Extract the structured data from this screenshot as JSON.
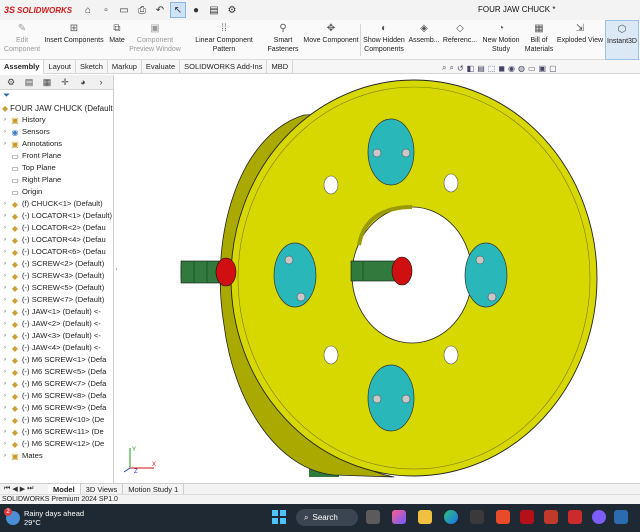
{
  "app": {
    "logo_text": "SOLIDWORKS",
    "logo_prefix": "3S",
    "document_title": "FOUR JAW CHUCK *"
  },
  "quick_access": [
    {
      "name": "home-icon",
      "glyph": "⌂"
    },
    {
      "name": "new-document-icon",
      "glyph": "▫"
    },
    {
      "name": "open-icon",
      "glyph": "▭"
    },
    {
      "name": "print-icon",
      "glyph": "⎙"
    },
    {
      "name": "undo-icon",
      "glyph": "↶"
    },
    {
      "name": "select-icon",
      "glyph": "↖"
    },
    {
      "name": "rebuild-icon",
      "glyph": "●"
    },
    {
      "name": "file-properties-icon",
      "glyph": "▤"
    },
    {
      "name": "options-icon",
      "glyph": "⚙"
    }
  ],
  "ribbon": {
    "edit_component": "Edit\nComponent",
    "insert_components": "Insert Components",
    "mate": "Mate",
    "component_preview": "Component\nPreview Window",
    "linear_pattern": "Linear Component Pattern",
    "smart_fasteners": "Smart\nFasteners",
    "move_component": "Move Component",
    "show_hidden": "Show Hidden\nComponents",
    "assembly": "Assemb...",
    "reference": "Referenc...",
    "new_motion_study": "New Motion\nStudy",
    "bill_of_materials": "Bill of\nMaterials",
    "exploded_view": "Exploded View",
    "instant3d": "Instant3D"
  },
  "command_tabs": [
    "Assembly",
    "Layout",
    "Sketch",
    "Markup",
    "Evaluate",
    "SOLIDWORKS Add-Ins",
    "MBD"
  ],
  "feature_tree": {
    "root": "FOUR JAW CHUCK  (Default",
    "items": [
      {
        "label": "History",
        "icon": "history-icon",
        "kind": "folder"
      },
      {
        "label": "Sensors",
        "icon": "sensor-icon",
        "kind": "sensor"
      },
      {
        "label": "Annotations",
        "icon": "annotations-icon",
        "kind": "folder"
      },
      {
        "label": "Front Plane",
        "icon": "plane-icon",
        "kind": "plane"
      },
      {
        "label": "Top Plane",
        "icon": "plane-icon",
        "kind": "plane"
      },
      {
        "label": "Right Plane",
        "icon": "plane-icon",
        "kind": "plane"
      },
      {
        "label": "Origin",
        "icon": "origin-icon",
        "kind": "plane"
      },
      {
        "label": "(f) CHUCK<1> (Default)",
        "icon": "part-icon",
        "kind": "part"
      },
      {
        "label": "(-) LOCATOR<1> (Default)",
        "icon": "part-icon",
        "kind": "part"
      },
      {
        "label": "(-) LOCATOR<2> (Defau",
        "icon": "part-icon",
        "kind": "part"
      },
      {
        "label": "(-) LOCATOR<4> (Defau",
        "icon": "part-icon",
        "kind": "part"
      },
      {
        "label": "(-) LOCATOR<6> (Defau",
        "icon": "part-icon",
        "kind": "part"
      },
      {
        "label": "(-) SCREW<2> (Default)",
        "icon": "part-icon",
        "kind": "part"
      },
      {
        "label": "(-) SCREW<3> (Default)",
        "icon": "part-icon",
        "kind": "part"
      },
      {
        "label": "(-) SCREW<5> (Default)",
        "icon": "part-icon",
        "kind": "part"
      },
      {
        "label": "(-) SCREW<7> (Default)",
        "icon": "part-icon",
        "kind": "part"
      },
      {
        "label": "(-) JAW<1> (Default) <-",
        "icon": "part-icon",
        "kind": "part"
      },
      {
        "label": "(-) JAW<2> (Default) <-",
        "icon": "part-icon",
        "kind": "part"
      },
      {
        "label": "(-) JAW<3> (Default) <-",
        "icon": "part-icon",
        "kind": "part"
      },
      {
        "label": "(-) JAW<4> (Default) <-",
        "icon": "part-icon",
        "kind": "part"
      },
      {
        "label": "(-) M6 SCREW<1> (Defa",
        "icon": "part-icon",
        "kind": "part"
      },
      {
        "label": "(-) M6 SCREW<5> (Defa",
        "icon": "part-icon",
        "kind": "part"
      },
      {
        "label": "(-) M6 SCREW<7> (Defa",
        "icon": "part-icon",
        "kind": "part"
      },
      {
        "label": "(-) M6 SCREW<8> (Defa",
        "icon": "part-icon",
        "kind": "part"
      },
      {
        "label": "(-) M6 SCREW<9> (Defa",
        "icon": "part-icon",
        "kind": "part"
      },
      {
        "label": "(-) M6 SCREW<10> (De",
        "icon": "part-icon",
        "kind": "part"
      },
      {
        "label": "(-) M6 SCREW<11> (De",
        "icon": "part-icon",
        "kind": "part"
      },
      {
        "label": "(-) M6 SCREW<12> (De",
        "icon": "part-icon",
        "kind": "part"
      },
      {
        "label": "Mates",
        "icon": "mates-icon",
        "kind": "folder"
      }
    ]
  },
  "model_tabs": [
    "Model",
    "3D Views",
    "Motion Study 1"
  ],
  "status_text": "SOLIDWORKS Premium 2024 SP1.0",
  "taskbar": {
    "weather_title": "Rainy days ahead",
    "weather_temp": "29°C",
    "weather_badge": "2",
    "search_label": "Search"
  },
  "colors": {
    "chuck_body": "#d7d800",
    "chuck_dark": "#a9a900",
    "jaw_pads": "#2ab7b9",
    "jaw_shafts": "#2f7a3c",
    "accent_red": "#d01010"
  }
}
